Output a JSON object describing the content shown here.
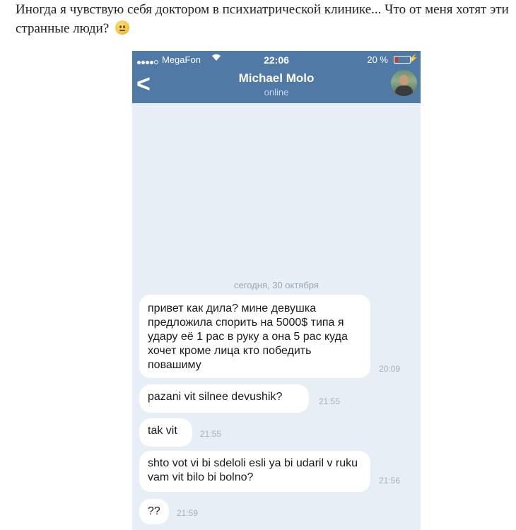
{
  "caption": {
    "text": "Иногда я чувствую себя доктором в психиатрической клинике... Что от меня хотят эти странные люди?"
  },
  "status_bar": {
    "carrier": "MegaFon",
    "time": "22:06",
    "battery": "20 %",
    "battery_level": 0.2
  },
  "header": {
    "back_glyph": "<",
    "name": "Michael Molo",
    "status": "online"
  },
  "chat": {
    "date_separator": "сегодня, 30 октября",
    "messages": [
      {
        "text": "привет как дила? мине девушка предложила спорить на 5000$ типа я удару её 1 рас в руку а она 5 рас куда хочет кроме лица кто победить повашиму",
        "time": "20:09"
      },
      {
        "text": "pazani vit silnee devushik?",
        "time": "21:55"
      },
      {
        "text": "tak vit",
        "time": "21:55"
      },
      {
        "text": "shto vot vi bi sdeloli esli ya bi udaril v ruku vam vit bilo bi bolno?",
        "time": "21:56"
      },
      {
        "text": "??",
        "time": "21:59"
      }
    ]
  },
  "colors": {
    "header_bg": "#5079a6",
    "chat_bg": "#e8eef6",
    "bubble_bg": "#ffffff",
    "battery_low": "#e0302a"
  }
}
